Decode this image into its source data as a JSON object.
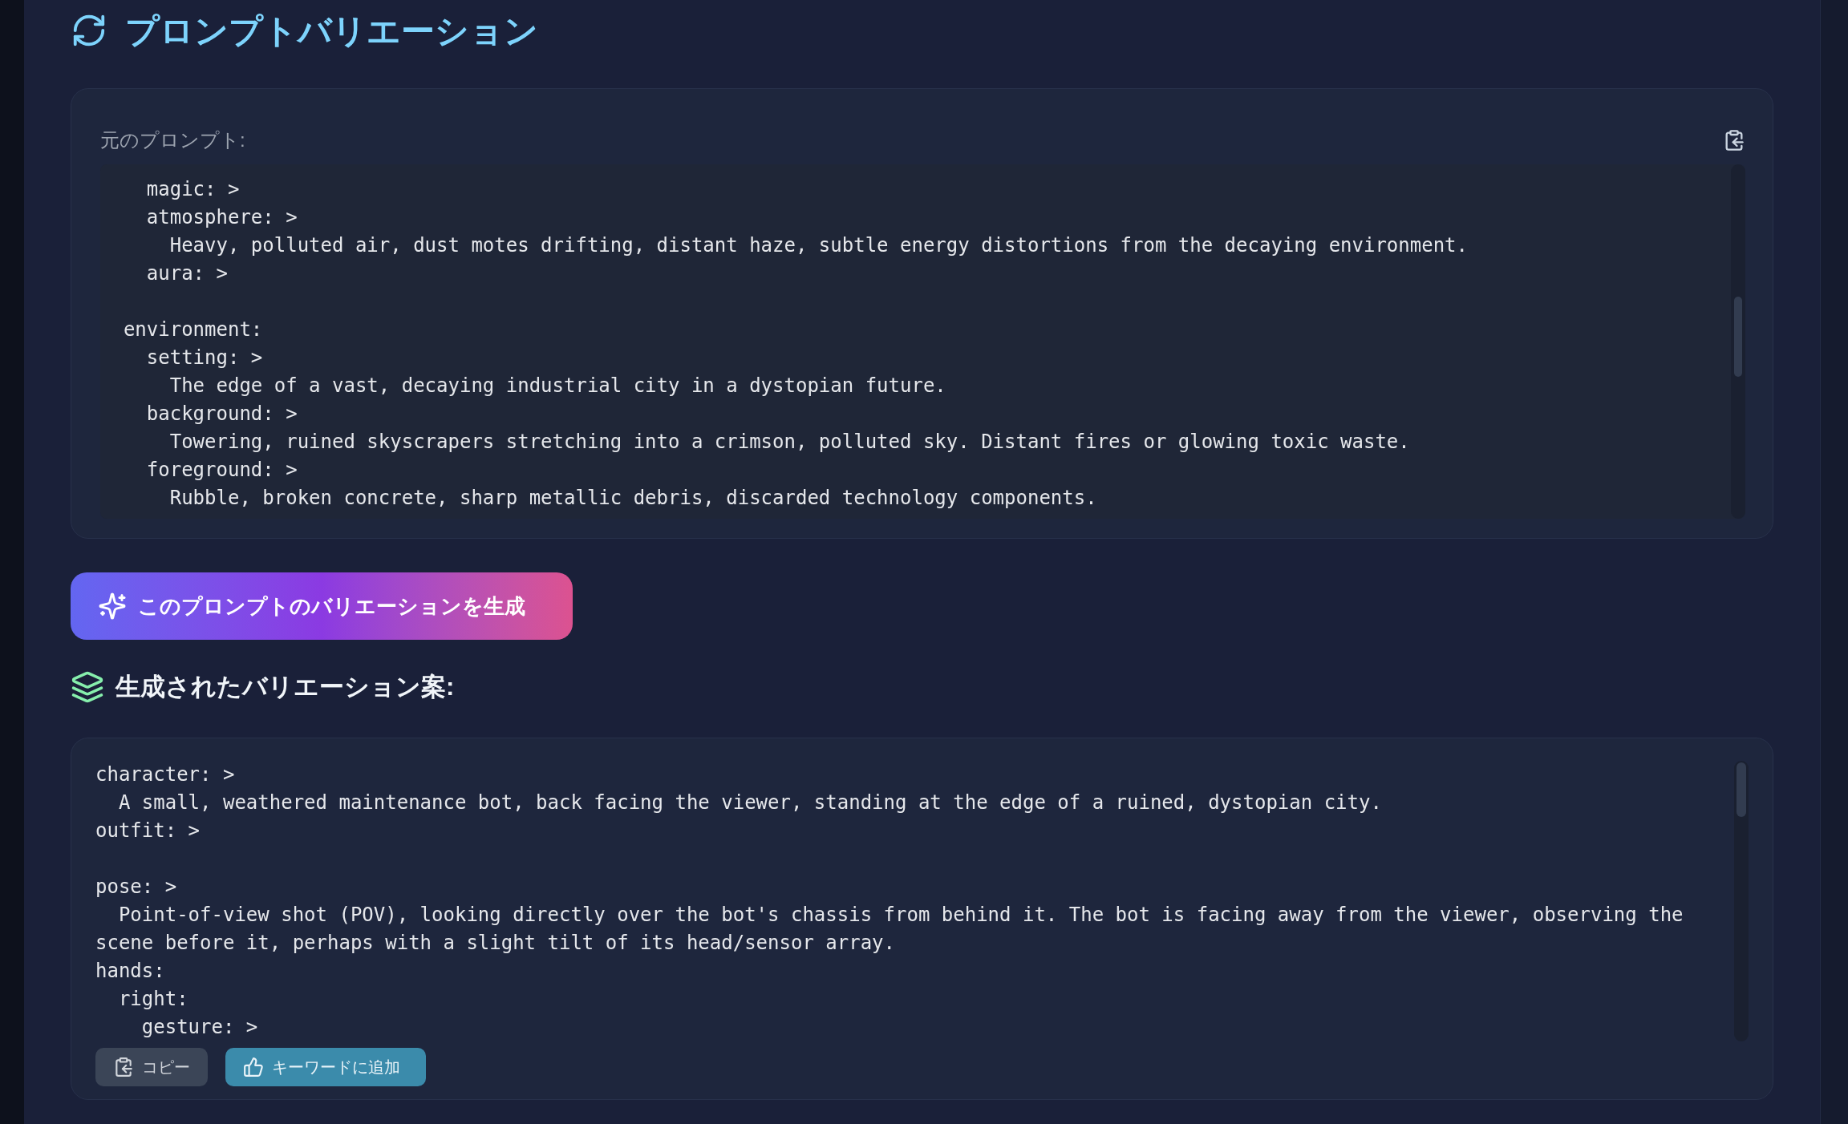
{
  "title": "プロンプトバリエーション",
  "original": {
    "label": "元のプロンプト:",
    "code": "    magic: >\n    atmosphere: >\n      Heavy, polluted air, dust motes drifting, distant haze, subtle energy distortions from the decaying environment.\n    aura: >\n\n  environment:\n    setting: >\n      The edge of a vast, decaying industrial city in a dystopian future.\n    background: >\n      Towering, ruined skyscrapers stretching into a crimson, polluted sky. Distant fires or glowing toxic waste.\n    foreground: >\n      Rubble, broken concrete, sharp metallic debris, discarded technology components."
  },
  "generate_button": {
    "label": "このプロンプトのバリエーションを生成"
  },
  "variations_heading": "生成されたバリエーション案:",
  "variation": {
    "code": "character: >\n  A small, weathered maintenance bot, back facing the viewer, standing at the edge of a ruined, dystopian city.\noutfit: >\n\npose: >\n  Point-of-view shot (POV), looking directly over the bot's chassis from behind it. The bot is facing away from the viewer, observing the scene before it, perhaps with a slight tilt of its head/sensor array.\nhands:\n  right:\n    gesture: >",
    "buttons": [
      {
        "kind": "copy",
        "label": "コピー"
      },
      {
        "kind": "keyword",
        "label": "キーワードに追加"
      }
    ]
  }
}
